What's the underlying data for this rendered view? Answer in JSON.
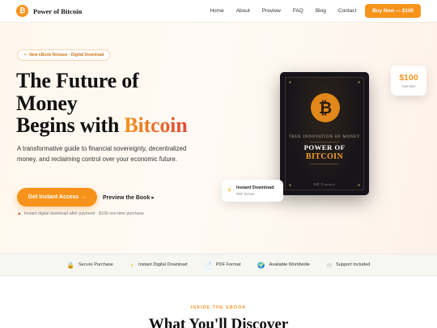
{
  "nav": {
    "brand_name": "Power of Bitcoin",
    "brand_symbol": "₿",
    "links": [
      "Home",
      "About",
      "Preview",
      "FAQ",
      "Blog",
      "Contact"
    ],
    "cta_label": "Buy Now — $100"
  },
  "hero": {
    "badge": "New eBook Release · Digital Download",
    "headline_line1": "The Future of",
    "headline_line2": "Money",
    "headline_line3_prefix": "Begins with ",
    "headline_line3_accent": "Bitcoin",
    "subtext": "A transformative guide to financial sovereignty, decentralized money, and reclaiming control over your economic future.",
    "primary_button": "Get Instant Access →",
    "secondary_button": "Preview the Book ▸",
    "note": "Instant digital download after payment · $100 one-time purchase"
  },
  "book": {
    "symbol": "₿",
    "kicker": "TRUE INNOVATION OF MONEY",
    "title_line1": "POWER OF",
    "title_line2": "BITCOIN",
    "author": "MD Finance"
  },
  "price_card": {
    "value": "$100",
    "sub": "One-time"
  },
  "download_card": {
    "title": "Instant Download",
    "sub": "PDF format"
  },
  "trust_items": [
    {
      "icon": "lock-icon",
      "glyph": "🔒",
      "label": "Secure Purchase"
    },
    {
      "icon": "bolt-icon",
      "glyph": "⚡",
      "label": "Instant Digital Download"
    },
    {
      "icon": "pdf-icon",
      "glyph": "📄",
      "label": "PDF Format"
    },
    {
      "icon": "globe-icon",
      "glyph": "🌍",
      "label": "Available Worldwide"
    },
    {
      "icon": "mail-icon",
      "glyph": "✉",
      "label": "Support Included"
    }
  ],
  "section": {
    "eyebrow": "INSIDE THE EBOOK",
    "title": "What You'll Discover"
  },
  "colors": {
    "accent": "#f7931a",
    "accent_end": "#e04b3a",
    "book_bg": "#16141a"
  }
}
